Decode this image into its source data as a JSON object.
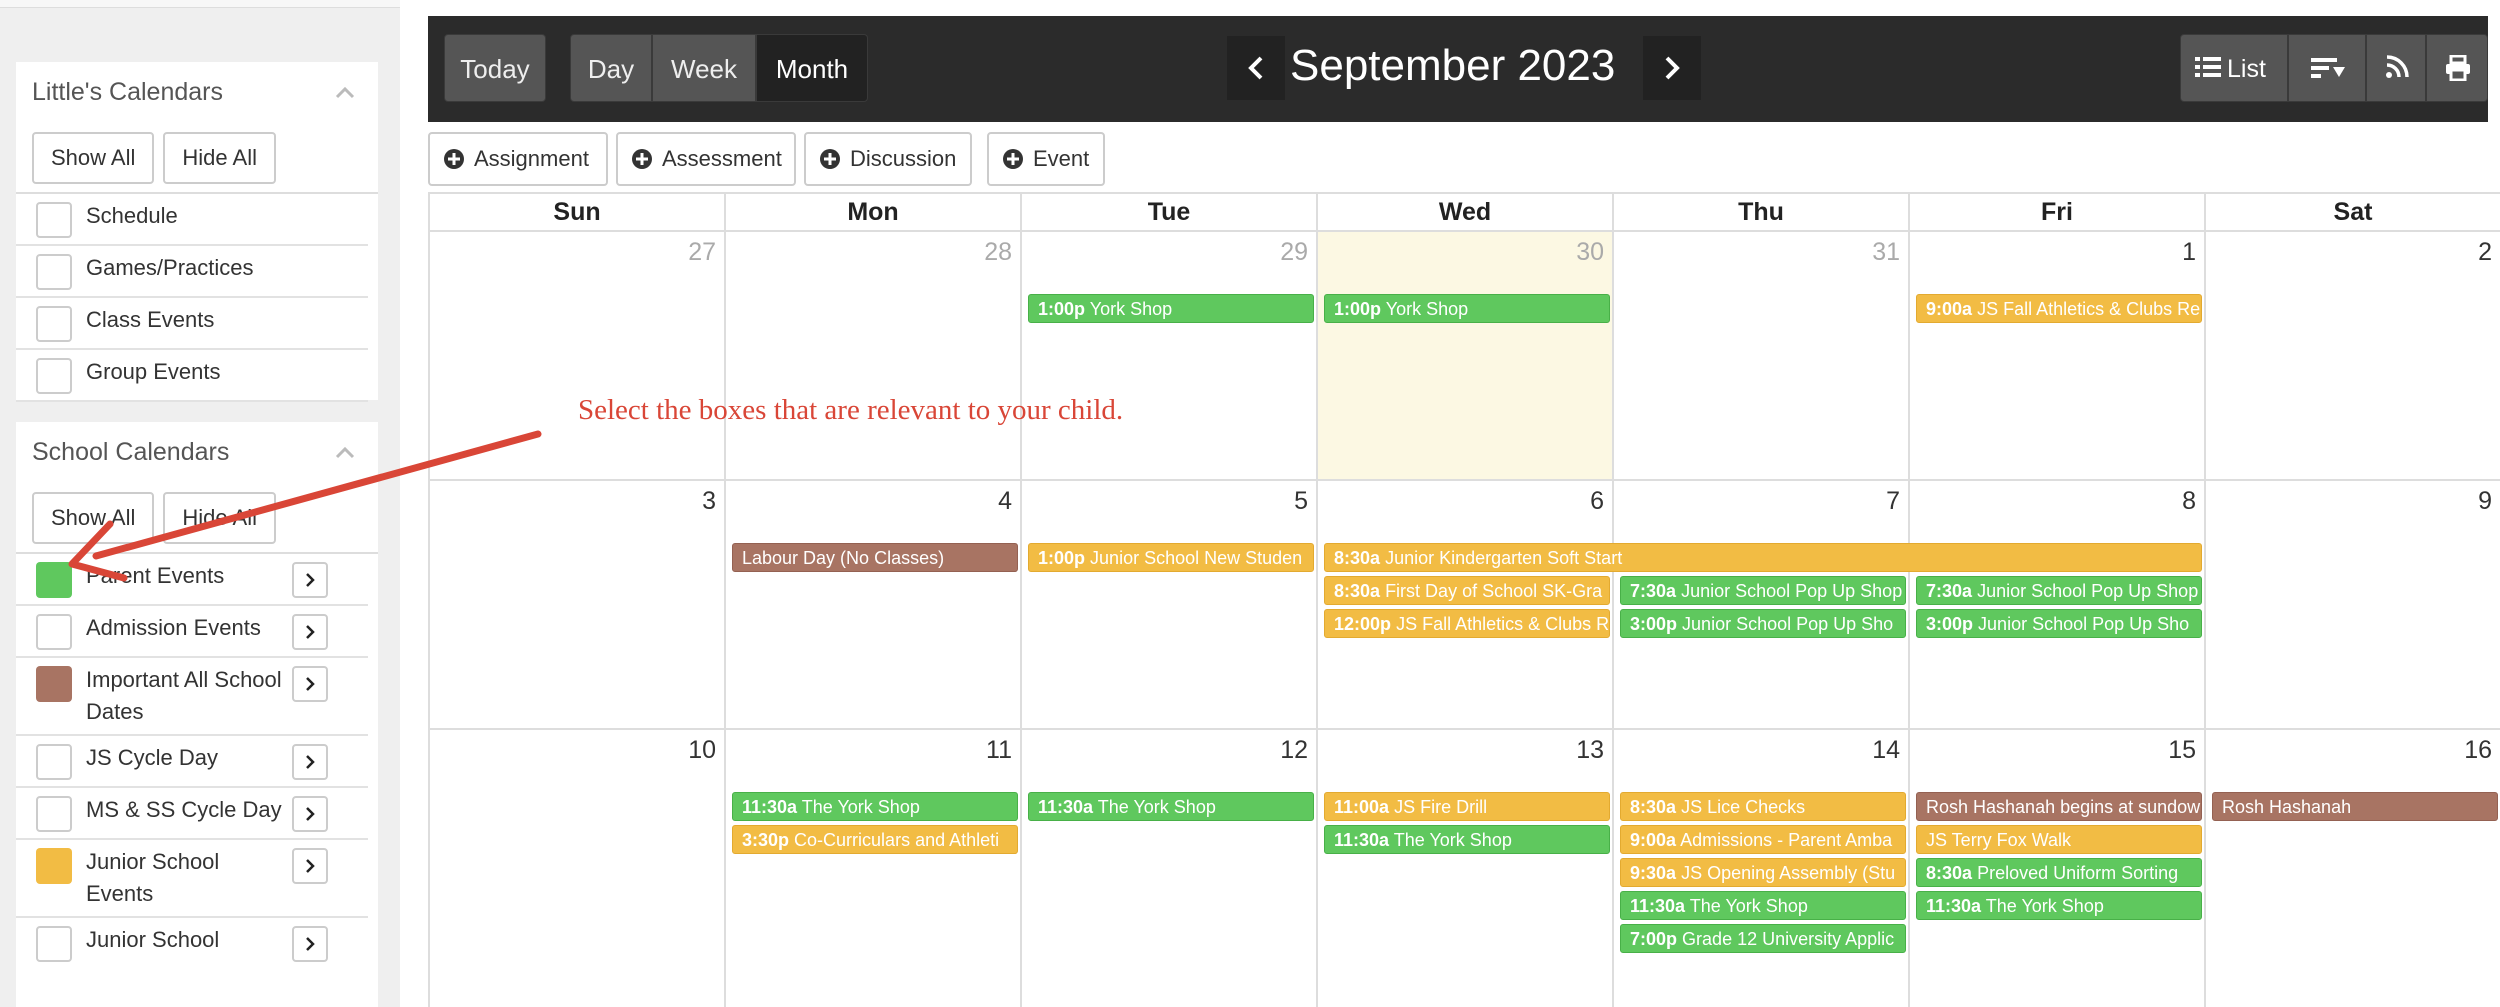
{
  "sidebar": {
    "personal": {
      "title": "Little's Calendars",
      "show_all": "Show All",
      "hide_all": "Hide All",
      "items": [
        {
          "label": "Schedule"
        },
        {
          "label": "Games/Practices"
        },
        {
          "label": "Class Events"
        },
        {
          "label": "Group Events"
        }
      ]
    },
    "school": {
      "title": "School Calendars",
      "show_all": "Show All",
      "hide_all": "Hide All",
      "items": [
        {
          "label": "Parent Events",
          "color": "#5fc85e"
        },
        {
          "label": "Admission Events",
          "color": null
        },
        {
          "label": "Important All School Dates",
          "color": "#a87463"
        },
        {
          "label": "JS Cycle Day",
          "color": null
        },
        {
          "label": "MS & SS Cycle Day",
          "color": null
        },
        {
          "label": "Junior School Events",
          "color": "#f2bc44"
        },
        {
          "label": "Junior School",
          "color": null
        }
      ]
    }
  },
  "toolbar": {
    "today": "Today",
    "day": "Day",
    "week": "Week",
    "month": "Month",
    "active_view": "Month",
    "title": "September 2023",
    "list": "List"
  },
  "add_buttons": {
    "assignment": "Assignment",
    "assessment": "Assessment",
    "discussion": "Discussion",
    "event": "Event"
  },
  "weekdays": [
    "Sun",
    "Mon",
    "Tue",
    "Wed",
    "Thu",
    "Fri",
    "Sat"
  ],
  "weeks": [
    [
      "27",
      "28",
      "29",
      "30",
      "31",
      "1",
      "2"
    ],
    [
      "3",
      "4",
      "5",
      "6",
      "7",
      "8",
      "9"
    ],
    [
      "10",
      "11",
      "12",
      "13",
      "14",
      "15",
      "16"
    ]
  ],
  "events": {
    "w1": {
      "tue": {
        "time": "1:00p",
        "title": "York Shop"
      },
      "wed": {
        "time": "1:00p",
        "title": "York Shop"
      },
      "fri": {
        "time": "9:00a",
        "title": "JS Fall Athletics & Clubs Re"
      }
    },
    "w2": {
      "mon": {
        "time": "",
        "title": "Labour Day (No Classes)"
      },
      "tue": {
        "time": "1:00p",
        "title": "Junior School New Studen"
      },
      "wed_fri": {
        "time": "8:30a",
        "title": "Junior Kindergarten Soft Start"
      },
      "wed_2": {
        "time": "8:30a",
        "title": "First Day of School SK-Gra"
      },
      "wed_3": {
        "time": "12:00p",
        "title": "JS Fall Athletics & Clubs R"
      },
      "thu_1": {
        "time": "7:30a",
        "title": "Junior School Pop Up Shop"
      },
      "thu_2": {
        "time": "3:00p",
        "title": "Junior School Pop Up Sho"
      },
      "fri_1": {
        "time": "7:30a",
        "title": "Junior School Pop Up Shop"
      },
      "fri_2": {
        "time": "3:00p",
        "title": "Junior School Pop Up Sho"
      }
    },
    "w3": {
      "mon_1": {
        "time": "11:30a",
        "title": "The York Shop"
      },
      "mon_2": {
        "time": "3:30p",
        "title": "Co-Curriculars and Athleti"
      },
      "tue_1": {
        "time": "11:30a",
        "title": "The York Shop"
      },
      "wed_1": {
        "time": "11:00a",
        "title": "JS Fire Drill"
      },
      "wed_2": {
        "time": "11:30a",
        "title": "The York Shop"
      },
      "thu_1": {
        "time": "8:30a",
        "title": "JS Lice Checks"
      },
      "thu_2": {
        "time": "9:00a",
        "title": "Admissions - Parent Amba"
      },
      "thu_3": {
        "time": "9:30a",
        "title": "JS Opening Assembly (Stu"
      },
      "thu_4": {
        "time": "11:30a",
        "title": "The York Shop"
      },
      "thu_5": {
        "time": "7:00p",
        "title": "Grade 12 University Applic"
      },
      "fri_1": {
        "time": "",
        "title": "Rosh Hashanah begins at sundow"
      },
      "fri_2": {
        "time": "",
        "title": "JS Terry Fox Walk"
      },
      "fri_3": {
        "time": "8:30a",
        "title": "Preloved Uniform Sorting"
      },
      "fri_4": {
        "time": "11:30a",
        "title": "The York Shop"
      },
      "sat_1": {
        "time": "",
        "title": "Rosh Hashanah"
      }
    }
  },
  "annotation": {
    "text": "Select the boxes that are relevant to your child.",
    "color": "#d94637"
  },
  "colors": {
    "parent_events": "#5fc85e",
    "important_dates": "#a87463",
    "junior_school_events": "#f2bc44",
    "toolbar_bg": "#2b2b2b",
    "today_bg": "#fcf8e3"
  }
}
